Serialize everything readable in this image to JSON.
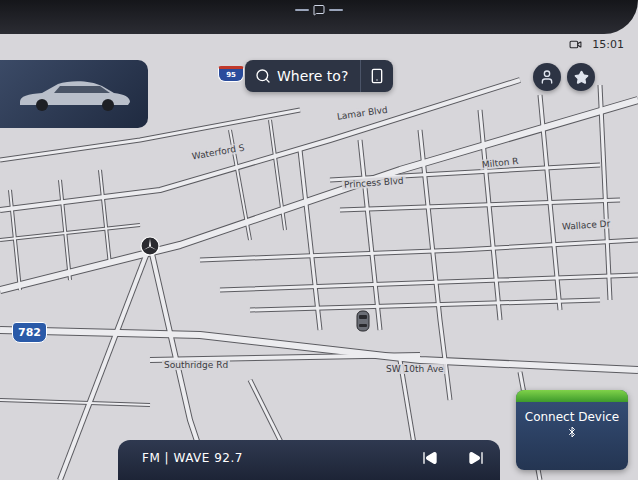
{
  "status_bar": {
    "time": "15:01"
  },
  "search": {
    "placeholder": "Where to?"
  },
  "map": {
    "labels": [
      {
        "text": "Lamar Blvd"
      },
      {
        "text": "Waterford S"
      },
      {
        "text": "Princess Blvd"
      },
      {
        "text": "Milton R"
      },
      {
        "text": "Wallace Dr"
      },
      {
        "text": "Southridge Rd"
      },
      {
        "text": "SW 10th Ave"
      }
    ],
    "shields": [
      {
        "text": "95",
        "kind": "interstate"
      },
      {
        "text": "782",
        "kind": "state"
      }
    ]
  },
  "media": {
    "station": "FM | WAVE 92.7"
  },
  "connect_device": {
    "label": "Connect Device"
  }
}
